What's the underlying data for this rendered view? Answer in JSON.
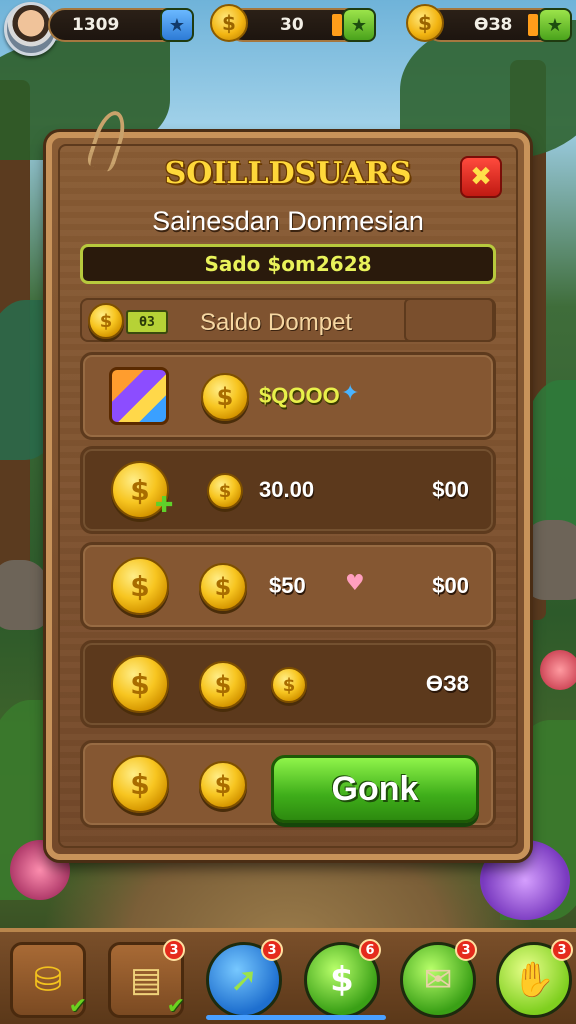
{
  "topbar": {
    "player_value": "1309",
    "coin_value_1": "30",
    "coin_value_2": "ӨЗ8",
    "coin_symbol": "$",
    "plus_icon": "star-icon"
  },
  "panel": {
    "title": "SOILLDSUARS",
    "subtitle": "Sainesdan Donmesian",
    "balance": "Sado $om2628",
    "wallet_icon_text": "ӨЗ",
    "wallet_label": "Saldo Dompet",
    "close_label": "✖"
  },
  "rows": [
    {
      "amount": "$QOOO",
      "price": ""
    },
    {
      "amount": "30.00",
      "price": "$00"
    },
    {
      "amount": "$50",
      "price": "$00"
    },
    {
      "amount": "",
      "price": "ӨЗ8"
    }
  ],
  "action": {
    "button_label": "Gonk"
  },
  "bottombar": {
    "badges": [
      "3",
      "3",
      "6",
      "3",
      "3"
    ]
  },
  "colors": {
    "title": "#ffd83a",
    "accent_green": "#3fae1a",
    "panel_wood": "#8a5d35",
    "close_red": "#e52a1c"
  }
}
